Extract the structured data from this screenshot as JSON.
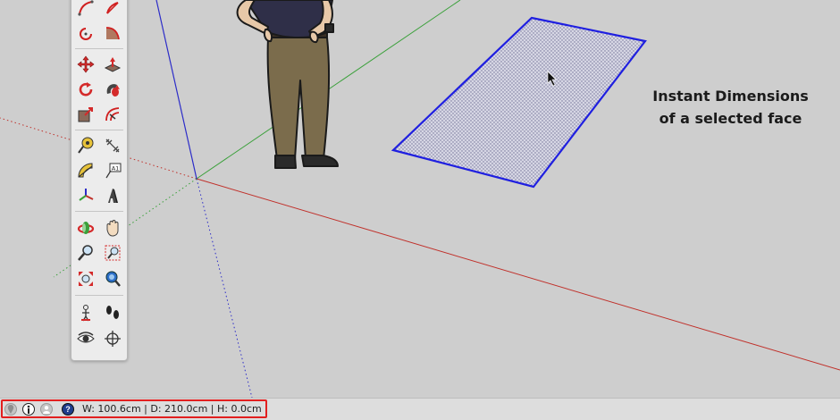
{
  "annotation": {
    "line1": "Instant Dimensions",
    "line2": "of a selected face"
  },
  "status_bar": {
    "measurements": "W: 100.6cm | D: 210.0cm | H: 0.0cm"
  },
  "colors": {
    "viewport_bg": "#cecece",
    "red_axis": "#c0302a",
    "green_axis": "#3aa03a",
    "blue_axis": "#2c2cc8",
    "selection": "#1f1fe0",
    "highlight": "#e21f1f"
  },
  "toolbar_icons": [
    "arc-icon",
    "pie-arc-icon",
    "rotate-arc-icon",
    "3-point-arc-icon",
    "move-icon",
    "push-pull-icon",
    "rotate-icon",
    "follow-me-icon",
    "scale-icon",
    "offset-icon",
    "tape-measure-icon",
    "dimension-icon",
    "protractor-icon",
    "text-icon",
    "axes-icon",
    "3d-text-icon",
    "orbit-icon",
    "pan-icon",
    "zoom-icon",
    "zoom-window-icon",
    "zoom-extents-icon",
    "previous-view-icon",
    "position-camera-icon",
    "walk-icon",
    "look-around-icon",
    "section-plane-icon"
  ]
}
